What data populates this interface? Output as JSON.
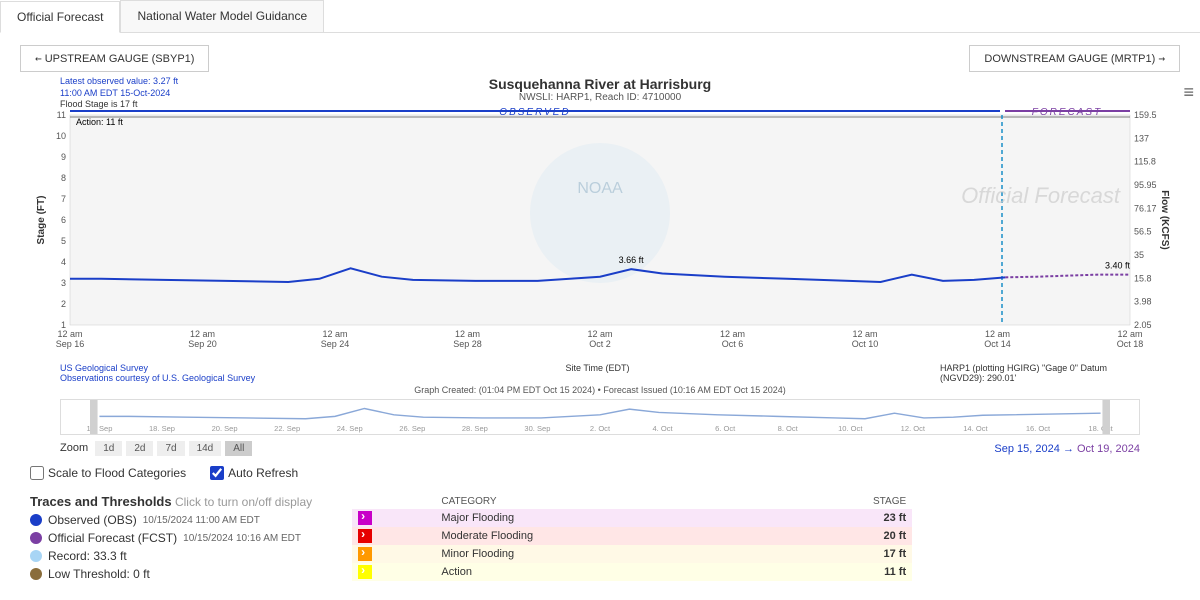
{
  "tabs": {
    "official": "Official Forecast",
    "nwm": "National Water Model Guidance"
  },
  "nav": {
    "upstream": "UPSTREAM GAUGE (SBYP1)",
    "downstream": "DOWNSTREAM GAUGE (MRTP1)"
  },
  "meta": {
    "latest": "Latest observed value: 3.27 ft",
    "ts": "11:00 AM EDT 15-Oct-2024",
    "flood": "Flood Stage is 17 ft"
  },
  "title": "Susquehanna River at Harrisburg",
  "subtitle": "NWSLI: HARP1, Reach ID: 4710000",
  "segments": {
    "observed": "OBSERVED",
    "forecast": "FORECAST"
  },
  "action_label": "Action: 11 ft",
  "watermark": "Official Forecast",
  "axes": {
    "ylabel_left": "Stage (FT)",
    "ylabel_right": "Flow (KCFS)",
    "xlabel": "Site Time (EDT)"
  },
  "annotations": {
    "peak": "3.66 ft",
    "fcst_end": "3.40 ft"
  },
  "credits": {
    "usgs1": "US Geological Survey",
    "usgs2": "Observations courtesy of U.S. Geological Survey",
    "datum": "HARP1 (plotting HGIRG) \"Gage 0\" Datum (NGVD29): 290.01'",
    "created": "Graph Created: (01:04 PM EDT Oct 15 2024) • Forecast Issued (10:16 AM EDT Oct 15 2024)"
  },
  "zoom": {
    "label": "Zoom",
    "buttons": [
      "1d",
      "2d",
      "7d",
      "14d",
      "All"
    ],
    "active": "All",
    "range_start": "Sep 15, 2024",
    "range_end": "Oct 19, 2024",
    "arrow": "→"
  },
  "opts": {
    "scale": "Scale to Flood Categories",
    "auto": "Auto Refresh"
  },
  "traces": {
    "heading": "Traces and Thresholds",
    "hint": "Click to turn on/off display",
    "items": [
      {
        "color": "#1a3ec8",
        "label": "Observed (OBS)",
        "ts": "10/15/2024 11:00 AM EDT"
      },
      {
        "color": "#7b3fa3",
        "label": "Official Forecast (FCST)",
        "ts": "10/15/2024 10:16 AM EDT"
      },
      {
        "color": "#a8d5f5",
        "label": "Record: 33.3 ft",
        "ts": ""
      },
      {
        "color": "#8a6d3b",
        "label": "Low Threshold: 0 ft",
        "ts": ""
      }
    ]
  },
  "cat_header": {
    "cat": "CATEGORY",
    "stage": "STAGE"
  },
  "categories": [
    {
      "label": "Major Flooding",
      "stage": "23 ft"
    },
    {
      "label": "Moderate Flooding",
      "stage": "20 ft"
    },
    {
      "label": "Minor Flooding",
      "stage": "17 ft"
    },
    {
      "label": "Action",
      "stage": "11 ft"
    }
  ],
  "chart_data": {
    "type": "line",
    "title": "Susquehanna River at Harrisburg",
    "xlabel": "Site Time (EDT)",
    "ylabel_left": "Stage (FT)",
    "ylabel_right": "Flow (KCFS)",
    "ylim_left": [
      1,
      11
    ],
    "left_ticks": [
      1,
      2,
      3,
      4,
      5,
      6,
      7,
      8,
      9,
      10,
      11
    ],
    "right_ticks": [
      2.05,
      3.98,
      15.8,
      35,
      56.5,
      76.17,
      95.95,
      115.8,
      137,
      159.5
    ],
    "x_ticks": [
      "12 am Sep 16",
      "12 am Sep 20",
      "12 am Sep 24",
      "12 am Sep 28",
      "12 am Oct 2",
      "12 am Oct 6",
      "12 am Oct 10",
      "12 am Oct 14",
      "12 am Oct 18"
    ],
    "action_line": 11,
    "forecast_split": "Oct 15 11:00",
    "series": [
      {
        "name": "Observed (OBS)",
        "color": "#1a3ec8",
        "x": [
          "Sep 15",
          "Sep 16",
          "Sep 18",
          "Sep 20",
          "Sep 22",
          "Sep 23",
          "Sep 24",
          "Sep 25",
          "Sep 26",
          "Sep 28",
          "Sep 30",
          "Oct 2",
          "Oct 3",
          "Oct 4",
          "Oct 6",
          "Oct 8",
          "Oct 10",
          "Oct 11",
          "Oct 12",
          "Oct 13",
          "Oct 14",
          "Oct 15"
        ],
        "y": [
          3.2,
          3.2,
          3.15,
          3.1,
          3.05,
          3.2,
          3.7,
          3.3,
          3.15,
          3.1,
          3.1,
          3.3,
          3.66,
          3.45,
          3.3,
          3.2,
          3.1,
          3.05,
          3.4,
          3.1,
          3.15,
          3.27
        ]
      },
      {
        "name": "Official Forecast (FCST)",
        "color": "#7b3fa3",
        "x": [
          "Oct 15",
          "Oct 16",
          "Oct 17",
          "Oct 18",
          "Oct 19"
        ],
        "y": [
          3.27,
          3.3,
          3.35,
          3.4,
          3.4
        ]
      }
    ],
    "navigator_x": [
      "16. Sep",
      "18. Sep",
      "20. Sep",
      "22. Sep",
      "24. Sep",
      "26. Sep",
      "28. Sep",
      "30. Sep",
      "2. Oct",
      "4. Oct",
      "6. Oct",
      "8. Oct",
      "10. Oct",
      "12. Oct",
      "14. Oct",
      "16. Oct",
      "18. Oct"
    ]
  }
}
